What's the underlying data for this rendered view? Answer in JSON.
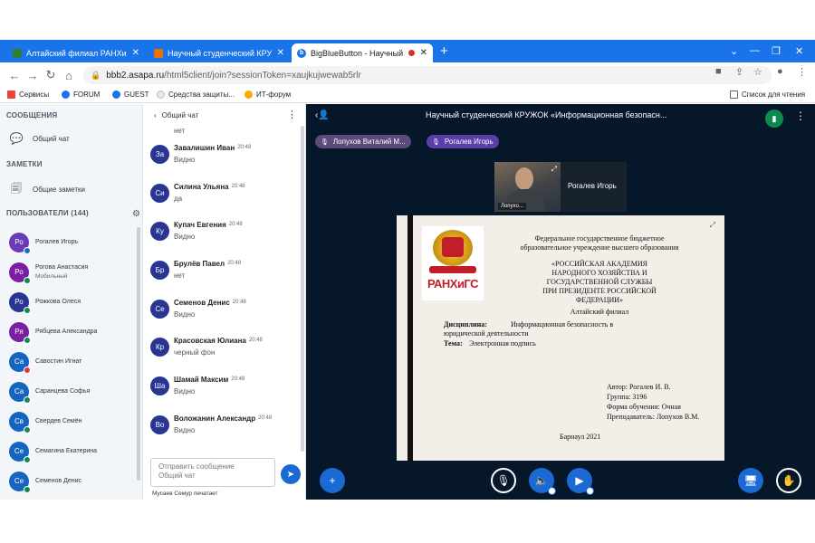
{
  "browser": {
    "tabs": [
      {
        "title": "Алтайский филиал РАНХиГС",
        "favicon_color": "#2f7d3a"
      },
      {
        "title": "Научный студенческий КРУЖОК",
        "favicon_color": "#e8710a"
      },
      {
        "title": "BigBlueButton - Научный ст",
        "favicon_color": "#1a73e8",
        "active": true
      }
    ],
    "url_host": "bbb2.asapa.ru",
    "url_path": "/html5client/join?sessionToken=xaujkujwewab5rlr",
    "bookmarks": [
      "Сервисы",
      "FORUM",
      "GUEST",
      "Средства защиты...",
      "ИТ-форум"
    ],
    "reading_list": "Список для чтения"
  },
  "sidebar": {
    "messages_title": "СООБЩЕНИЯ",
    "public_chat": "Общий чат",
    "notes_title": "ЗАМЕТКИ",
    "shared_notes": "Общие заметки",
    "users_title": "ПОЛЬЗОВАТЕЛИ (144)",
    "users": [
      {
        "initials": "Ро",
        "name": "Рогалев Игорь",
        "sub": "",
        "color": "#6a3bb7",
        "status": "#1b6ad4"
      },
      {
        "initials": "Ро",
        "name": "Рогова Анастасия",
        "sub": "Мобильный",
        "color": "#7b1fa2",
        "status": "#0f8a4e"
      },
      {
        "initials": "Ро",
        "name": "Рожкова Олеся",
        "sub": "",
        "color": "#283593",
        "status": "#0f8a4e"
      },
      {
        "initials": "Ря",
        "name": "Рябцева Александра",
        "sub": "",
        "color": "#7b1fa2",
        "status": "#0f8a4e"
      },
      {
        "initials": "Са",
        "name": "Савостин Игнат",
        "sub": "",
        "color": "#1565c0",
        "status": "#e53935"
      },
      {
        "initials": "Са",
        "name": "Саранцева Софья",
        "sub": "",
        "color": "#1565c0",
        "status": "#0f8a4e"
      },
      {
        "initials": "Св",
        "name": "Свердев Семён",
        "sub": "",
        "color": "#1565c0",
        "status": "#0f8a4e"
      },
      {
        "initials": "Се",
        "name": "Семагина Екатерина",
        "sub": "",
        "color": "#1565c0",
        "status": "#0f8a4e"
      },
      {
        "initials": "Се",
        "name": "Семенов Денис",
        "sub": "",
        "color": "#1565c0",
        "status": "#0f8a4e"
      }
    ]
  },
  "chat": {
    "title": "Общий чат",
    "cut_text": "нет",
    "messages": [
      {
        "initials": "За",
        "name": "Завалишин Иван",
        "time": "20:48",
        "text": "Видно",
        "color": "#283593"
      },
      {
        "initials": "Си",
        "name": "Силина Ульяна",
        "time": "20:48",
        "text": "да",
        "color": "#283593"
      },
      {
        "initials": "Ку",
        "name": "Купач Евгения",
        "time": "20:48",
        "text": "Видно",
        "color": "#283593"
      },
      {
        "initials": "Бр",
        "name": "Брулёв Павел",
        "time": "20:48",
        "text": "нет",
        "color": "#283593"
      },
      {
        "initials": "Се",
        "name": "Семенов Денис",
        "time": "20:48",
        "text": "Видно",
        "color": "#283593"
      },
      {
        "initials": "Кр",
        "name": "Красовская Юлиана",
        "time": "20:48",
        "text": "черный фон",
        "color": "#283593"
      },
      {
        "initials": "Ша",
        "name": "Шамай Максим",
        "time": "20:48",
        "text": "Видно",
        "color": "#283593"
      },
      {
        "initials": "Во",
        "name": "Воложанин Александр",
        "time": "20:48",
        "text": "Видно",
        "color": "#283593"
      }
    ],
    "input_placeholder_line1": "Отправить сообщение",
    "input_placeholder_line2": "Общий чат",
    "typing": "Мусаев Семур печатает"
  },
  "presentation": {
    "title": "Научный студенческий КРУЖОК «Информационная безопасн...",
    "talkers": [
      "Лопухов Виталий М...",
      "Рогалев Игорь"
    ],
    "webcams": [
      {
        "label": "Лопухо..."
      },
      {
        "label": "Рогалев Игорь"
      }
    ],
    "slide": {
      "logo_text": "РАНХиГС",
      "header_line1": "Федеральное государственное бюджетное",
      "header_line2": "образовательное учреждение высшего образования",
      "academy_line1": "«РОССИЙСКАЯ АКАДЕМИЯ",
      "academy_line2": "НАРОДНОГО ХОЗЯЙСТВА И",
      "academy_line3": "ГОСУДАРСТВЕННОЙ СЛУЖБЫ",
      "academy_line4": "ПРИ ПРЕЗИДЕНТЕ РОССИЙСКОЙ",
      "academy_line5": "ФЕДЕРАЦИИ»",
      "branch": "Алтайский филиал",
      "discipline_label": "Дисциплина:",
      "discipline_value1": "Информационная      безопасность      в",
      "discipline_value2": "юридической деятельности",
      "theme_label": "Тема:",
      "theme_value": "Электронная подпись",
      "author": "Автор: Рогалев И. В.",
      "group": "Группа: 3196",
      "study_form": "Форма обучения: Очная",
      "teacher": "Преподаватель: Лопухов В.М.",
      "city_year": "Барнаул 2021"
    }
  }
}
